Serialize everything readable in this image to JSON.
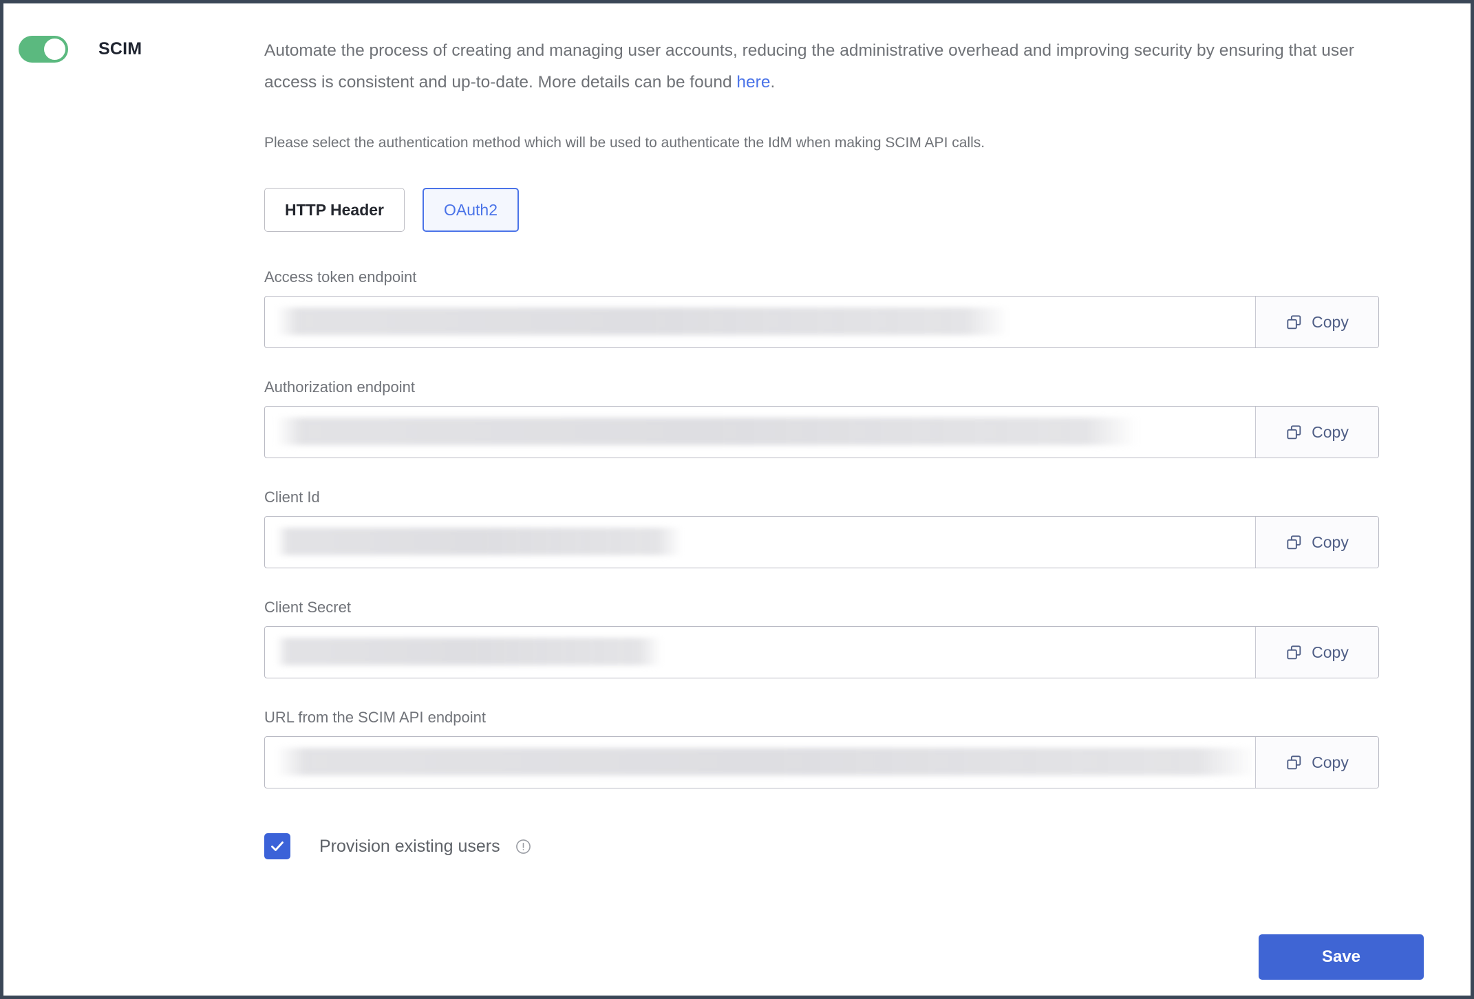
{
  "feature": {
    "name": "SCIM",
    "enabled": true,
    "toggle_icon": "toggle-on-icon"
  },
  "description": {
    "part1": "Automate the process of creating and managing user accounts, reducing the administrative overhead and improving security by ensuring that user access is consistent and up-to-date. More details can be found ",
    "link_text": "here",
    "part2": "."
  },
  "instruction": "Please select the authentication method which will be used to authenticate the IdM when making SCIM API calls.",
  "auth_tabs": [
    {
      "label": "HTTP Header",
      "selected": false
    },
    {
      "label": "OAuth2",
      "selected": true
    }
  ],
  "fields": [
    {
      "label": "Access token endpoint",
      "value": "",
      "redacted": true,
      "redaction_width_pct": 74,
      "copy_label": "Copy",
      "copy_icon": "copy-icon"
    },
    {
      "label": "Authorization endpoint",
      "value": "",
      "redacted": true,
      "redaction_width_pct": 87,
      "copy_label": "Copy",
      "copy_icon": "copy-icon"
    },
    {
      "label": "Client Id",
      "value": "",
      "redacted": true,
      "redaction_width_pct": 41,
      "copy_label": "Copy",
      "copy_icon": "copy-icon"
    },
    {
      "label": "Client Secret",
      "value": "",
      "redacted": true,
      "redaction_width_pct": 39,
      "copy_label": "Copy",
      "copy_icon": "copy-icon"
    },
    {
      "label": "URL from the SCIM API endpoint",
      "value": "",
      "redacted": true,
      "redaction_width_pct": 99,
      "copy_label": "Copy",
      "copy_icon": "copy-icon"
    }
  ],
  "checkbox": {
    "label": "Provision existing users",
    "checked": true,
    "info_icon": "info-icon"
  },
  "actions": {
    "save_label": "Save"
  },
  "colors": {
    "toggle_on": "#5bb97f",
    "accent_blue": "#4a73e8",
    "save_blue": "#3f65d4",
    "checkbox_blue": "#3b62d8",
    "text_gray": "#6f7277",
    "border_gray": "#b9bac4",
    "frame": "#3b4757"
  }
}
